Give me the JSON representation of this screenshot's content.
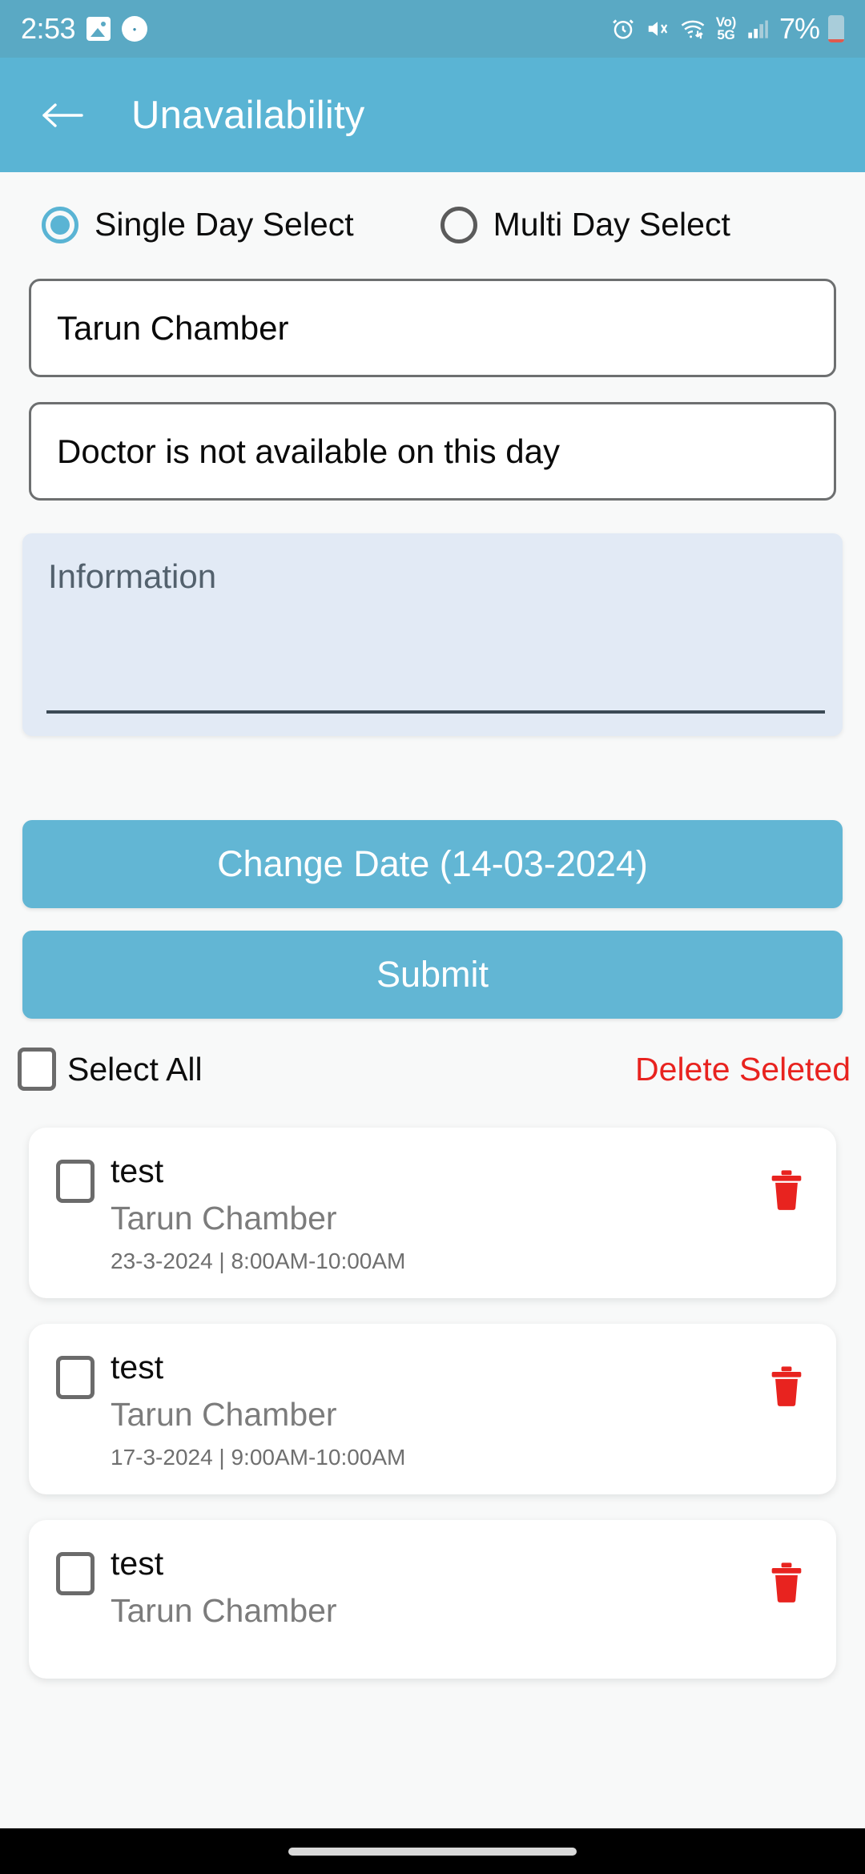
{
  "status_bar": {
    "time": "2:53",
    "battery_percent": "7%",
    "network_label_top": "Vo)",
    "network_label_bottom": "5G",
    "icons": [
      "gallery-icon",
      "app-badge-icon",
      "alarm-icon",
      "mute-icon",
      "wifi-icon",
      "volte-5g-icon",
      "cell-signal-icon",
      "battery-icon"
    ]
  },
  "app_bar": {
    "title": "Unavailability",
    "back_icon": "arrow-left-icon"
  },
  "mode_select": {
    "options": [
      {
        "label": "Single Day Select",
        "selected": true
      },
      {
        "label": "Multi Day Select",
        "selected": false
      }
    ]
  },
  "form": {
    "chamber_value": "Tarun Chamber",
    "reason_value": "Doctor is not available on this day",
    "information_placeholder": "Information",
    "information_value": ""
  },
  "actions": {
    "change_date_label": "Change Date (14-03-2024)",
    "change_date_value": "14-03-2024",
    "submit_label": "Submit"
  },
  "bulk_bar": {
    "select_all_label": "Select All",
    "select_all_checked": false,
    "delete_selected_label": "Delete Seleted",
    "delete_selected_color": "#e8231f"
  },
  "list": {
    "items": [
      {
        "title": "test",
        "chamber": "Tarun Chamber",
        "meta": "23-3-2024 | 8:00AM-10:00AM",
        "checked": false,
        "delete_icon": "trash-icon"
      },
      {
        "title": "test",
        "chamber": "Tarun Chamber",
        "meta": "17-3-2024 | 9:00AM-10:00AM",
        "checked": false,
        "delete_icon": "trash-icon"
      },
      {
        "title": "test",
        "chamber": "Tarun Chamber",
        "meta": "",
        "checked": false,
        "delete_icon": "trash-icon"
      }
    ]
  },
  "theme": {
    "primary": "#5ab4d4",
    "status_bar_bg": "#5aa9c4",
    "page_bg": "#f8f9f9",
    "info_bg": "#e2eaf5",
    "danger": "#e8231f"
  }
}
